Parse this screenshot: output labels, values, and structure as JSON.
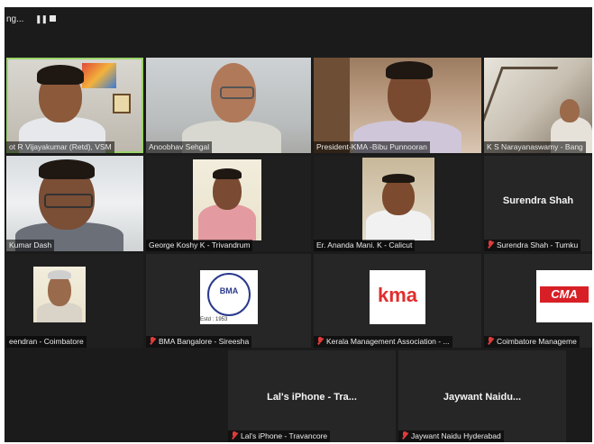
{
  "topbar": {
    "recording_label": "ng...",
    "pause_icon": "pause-icon",
    "stop_icon": "stop-icon"
  },
  "participants": [
    {
      "name": "ot R Vijayakumar (Retd), VSM",
      "muted": false
    },
    {
      "name": "Anoobhav Sehgal",
      "muted": false
    },
    {
      "name": "President-KMA -Bibu Punnooran",
      "muted": false
    },
    {
      "name": "K S Narayanaswamy - Bang",
      "muted": false
    },
    {
      "name": "Kumar Dash",
      "muted": false
    },
    {
      "name": "George Koshy K - Trivandrum",
      "muted": false
    },
    {
      "name": "Er. Ananda Mani. K - Calicut",
      "muted": false
    },
    {
      "name": "Surendra Shah - Tumku",
      "display": "Surendra Shah",
      "muted": true
    },
    {
      "name": "eendran - Coimbatore",
      "muted": false
    },
    {
      "name": "BMA Bangalore - Sireesha",
      "muted": true
    },
    {
      "name": "Kerala Management Association - ...",
      "muted": true
    },
    {
      "name": "Coimbatore Manageme",
      "muted": true
    },
    {
      "name": "Lal's iPhone - Travancore",
      "display": "Lal's iPhone - Tra...",
      "muted": true
    },
    {
      "name": "Jaywant Naidu Hyderabad",
      "display": "Jaywant Naidu...",
      "muted": true
    }
  ],
  "logos": {
    "bma": {
      "text": "BMA",
      "est": "Estd : 1953"
    },
    "kma": {
      "text": "kma"
    },
    "cma": {
      "text": "CMA"
    }
  },
  "colors": {
    "active_speaker_border": "#9bd36a",
    "muted_icon": "#e03b3b",
    "background": "#1b1b1b"
  }
}
